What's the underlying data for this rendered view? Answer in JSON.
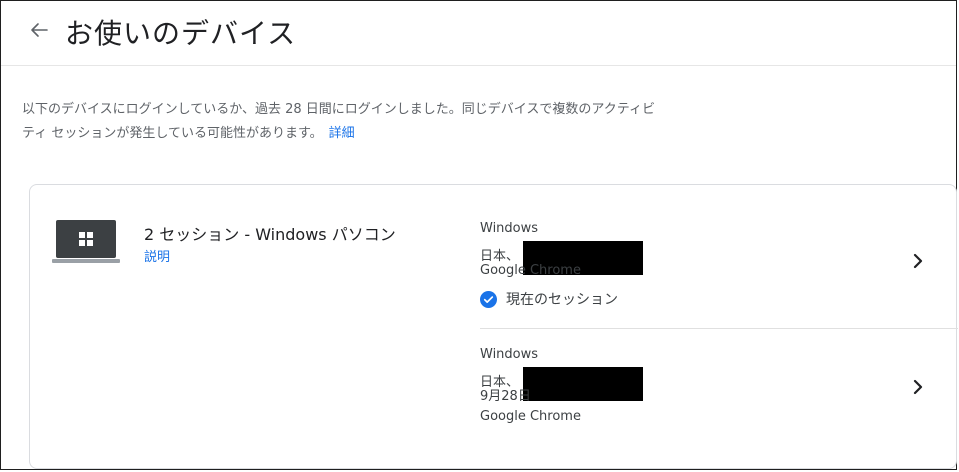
{
  "header": {
    "title": "お使いのデバイス"
  },
  "description": {
    "text": "以下のデバイスにログインしているか、過去 28 日間にログインしました。同じデバイスで複数のアクティビティ セッションが発生している可能性があります。",
    "link": "詳細"
  },
  "device": {
    "title": "2 セッション - Windows パソコン",
    "help": "説明",
    "icon": "laptop-windows-icon"
  },
  "sessions": [
    {
      "os": "Windows",
      "location": "日本、",
      "browser": "Google Chrome",
      "current_label": "現在のセッション"
    },
    {
      "os": "Windows",
      "location": "日本、",
      "date": "9月28日",
      "browser": "Google Chrome"
    }
  ],
  "colors": {
    "link": "#1a73e8",
    "check": "#1a73e8",
    "border": "#dadce0"
  }
}
